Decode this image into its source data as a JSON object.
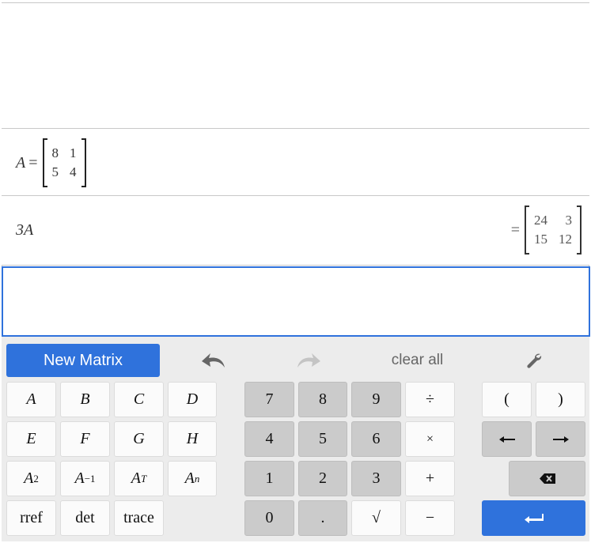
{
  "expressions": [
    {
      "lhs_var": "A",
      "lhs_op": "=",
      "matrix": [
        [
          "8",
          "1"
        ],
        [
          "5",
          "4"
        ]
      ]
    },
    {
      "lhs": "3A",
      "result_op": "=",
      "result": [
        [
          "24",
          "3"
        ],
        [
          "15",
          "12"
        ]
      ]
    }
  ],
  "input": {
    "value": ""
  },
  "keypad": {
    "new_matrix": "New Matrix",
    "clear_all": "clear all",
    "vars": [
      "A",
      "B",
      "C",
      "D",
      "E",
      "F",
      "G",
      "H"
    ],
    "powers": [
      {
        "base": "A",
        "exp": "2"
      },
      {
        "base": "A",
        "exp": "−1"
      },
      {
        "base": "A",
        "exp": "T"
      },
      {
        "base": "A",
        "exp": "n"
      }
    ],
    "functions": [
      "rref",
      "det",
      "trace"
    ],
    "digits": [
      "7",
      "8",
      "9",
      "4",
      "5",
      "6",
      "1",
      "2",
      "3",
      "0",
      "."
    ],
    "ops": {
      "divide": "÷",
      "times": "×",
      "plus": "+",
      "minus": "−",
      "sqrt": "√"
    },
    "parens": {
      "open": "(",
      "close": ")"
    },
    "arrows": {
      "left": "⟵",
      "right": "⟶"
    }
  },
  "colors": {
    "accent": "#2f72dc",
    "key_gray": "#cbcbcb",
    "key_white": "#fbfbfb",
    "panel": "#ececec"
  }
}
